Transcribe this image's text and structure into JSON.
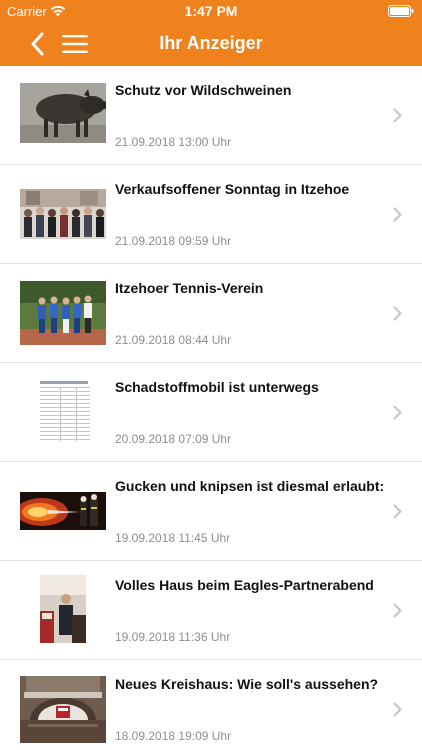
{
  "status_bar": {
    "carrier": "Carrier",
    "time": "1:47 PM"
  },
  "nav": {
    "title": "Ihr Anzeiger"
  },
  "colors": {
    "accent": "#f0821e"
  },
  "articles": [
    {
      "title": "Schutz vor Wildschweinen",
      "date": "21.09.2018 13:00 Uhr",
      "image": "wild-boar-photo"
    },
    {
      "title": "Verkaufsoffener Sonntag in Itzehoe",
      "date": "21.09.2018 09:59 Uhr",
      "image": "crowd-photo"
    },
    {
      "title": "Itzehoer Tennis-Verein",
      "date": "21.09.2018 08:44 Uhr",
      "image": "tennis-team-photo"
    },
    {
      "title": "Schadstoffmobil ist unterwegs",
      "date": "20.09.2018 07:09 Uhr",
      "image": "schedule-document"
    },
    {
      "title": "Gucken und knipsen ist diesmal erlaubt:",
      "date": "19.09.2018 11:45 Uhr",
      "image": "firefighters-photo"
    },
    {
      "title": "Volles Haus beim Eagles-Partnerabend",
      "date": "19.09.2018 11:36 Uhr",
      "image": "speaker-photo"
    },
    {
      "title": "Neues Kreishaus: Wie soll's aussehen?",
      "date": "18.09.2018 19:09 Uhr",
      "image": "building-model-photo"
    }
  ]
}
